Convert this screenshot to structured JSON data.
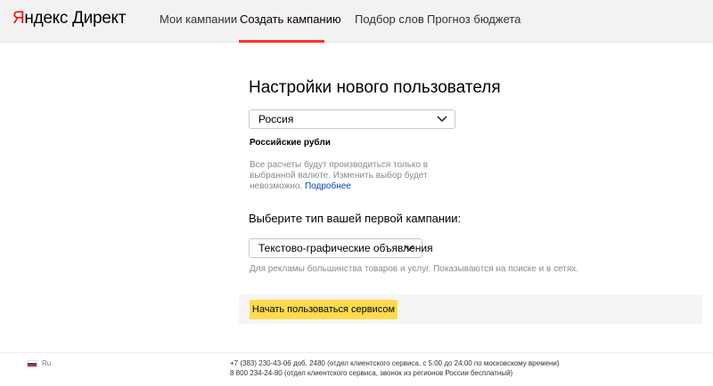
{
  "header": {
    "logo_y": "Я",
    "logo_rest": "ндекс Директ",
    "nav": [
      {
        "label": "Мои кампании"
      },
      {
        "label": "Создать кампанию"
      },
      {
        "label": "Подбор слов"
      },
      {
        "label": "Прогноз бюджета"
      }
    ],
    "active_color": "#ff3333"
  },
  "main": {
    "title": "Настройки нового пользователя",
    "country_select": {
      "value": "Россия"
    },
    "currency": "Российские рубли",
    "currency_note": "Все расчеты будут производиться только в выбранной валюте. Изменить выбор будет невозможно.",
    "currency_note_link": "Подробнее",
    "campaign_prompt": "Выберите тип вашей первой кампании:",
    "campaign_select": {
      "value": "Текстово-графические объявления"
    },
    "campaign_hint": "Для рекламы большинства товаров и услуг. Показываются на поиске и в сетях.",
    "start_button": "Начать пользоваться сервисом",
    "button_color": "#ffdb4d"
  },
  "footer": {
    "lang": "Ru",
    "lang_icon": "russia-flag-icon",
    "phone1": "+7 (383) 230-43-06 доб. 2480 (отдел клиентского сервиса, с 5:00 до 24:00 по московскому времени)",
    "phone2": "8 800 234-24-80 (отдел клиентского сервиса, звонок из регионов России бесплатный)"
  }
}
